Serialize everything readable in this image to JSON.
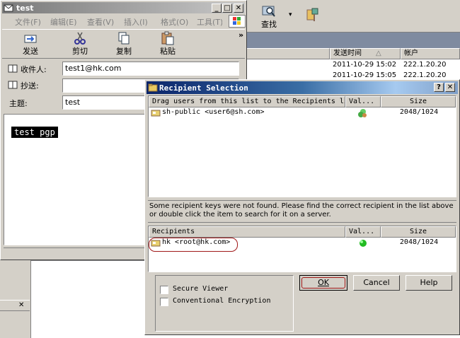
{
  "back_window": {
    "search_label": "查找",
    "columns": [
      "发送时间",
      "帐户"
    ],
    "sort_glyph": "△",
    "rows": [
      {
        "time": "2011-10-29 15:02",
        "account": "222.1.20.20"
      },
      {
        "time": "2011-10-29 15:05",
        "account": "222.1.20.20"
      }
    ],
    "chevron": "▾"
  },
  "compose": {
    "title": "test",
    "menu": [
      "文件(F)",
      "编辑(E)",
      "查看(V)",
      "插入(I)",
      "格式(O)",
      "工具(T)"
    ],
    "toolbar": {
      "send": "发送",
      "cut": "剪切",
      "copy": "复制",
      "paste": "粘贴",
      "more": "»"
    },
    "to_label": "收件人:",
    "to_value": "test1@hk.com",
    "cc_label": "抄送:",
    "cc_value": "",
    "subject_label": "主题:",
    "subject_value": "test",
    "body_text": "test pgp"
  },
  "dialog": {
    "title": "Recipient Selection",
    "help_btn": "?",
    "close_btn": "✕",
    "top_list": {
      "columns": [
        "Drag users from this list to the Recipients list",
        "Val...",
        "Size"
      ],
      "rows": [
        {
          "name": "sh-public <user6@sh.com>",
          "size": "2048/1024"
        }
      ]
    },
    "message": "Some recipient keys were not found. Please find the correct recipient in the list above or double click the item to search for it on a server.",
    "recipients": {
      "columns": [
        "Recipients",
        "Val...",
        "Size"
      ],
      "rows": [
        {
          "name": "hk <root@hk.com>",
          "size": "2048/1024"
        }
      ]
    },
    "options": {
      "secure_viewer": "Secure Viewer",
      "conventional": "Conventional Encryption"
    },
    "buttons": {
      "ok": "OK",
      "cancel": "Cancel",
      "help": "Help"
    }
  },
  "bottom_panel": {
    "close": "✕"
  }
}
